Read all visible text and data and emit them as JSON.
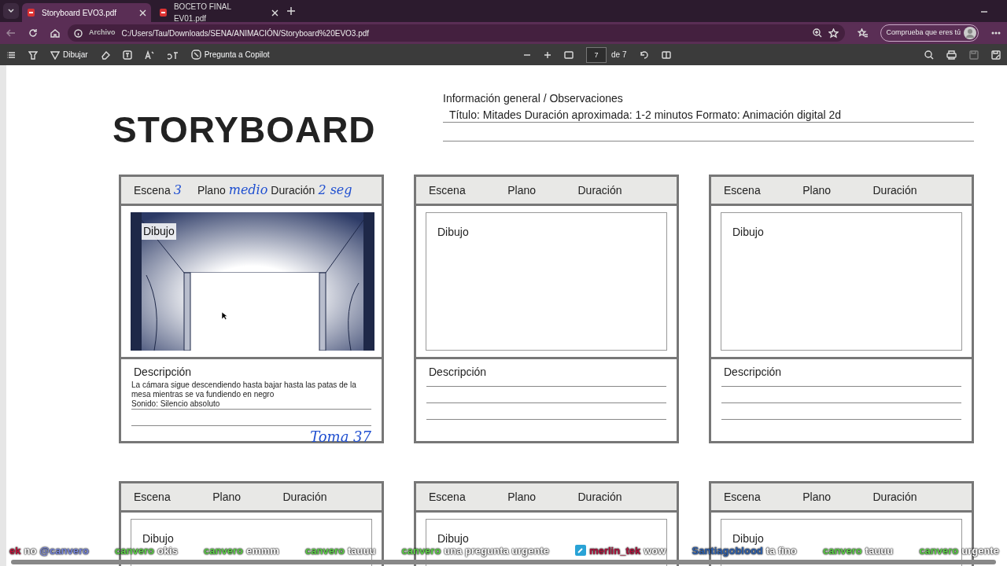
{
  "tabs": [
    {
      "label": "Storyboard EVO3.pdf",
      "selected": true
    },
    {
      "label": "BOCETO FINAL EV01.pdf",
      "selected": false
    }
  ],
  "address": {
    "prefix": "Archivo",
    "url": "C:/Users/Tau/Downloads/SENA/ANIMACIÓN/Storyboard%20EVO3.pdf"
  },
  "profile_button": "Comprueba que eres tú",
  "toolbar": {
    "draw": "Dibujar",
    "copilot": "Pregunta a Copilot",
    "page": "7",
    "page_total": "de 7"
  },
  "document": {
    "title": "STORYBOARD",
    "info_heading": "Información general / Observaciones",
    "info_text": "Título: Mitades Duración aproximada: 1-2 minutos Formato: Animación digital 2d",
    "panels": [
      {
        "kind": "full",
        "scene": "Escena",
        "scene_value": "3",
        "shot": "Plano",
        "shot_value": "medio",
        "duration": "Duración",
        "duration_value": "2 seg",
        "drawing": "Dibujo",
        "sketch": true,
        "description": "Descripción",
        "description_text": "La cámara sigue descendiendo hasta bajar hasta las patas de la mesa mientras se va fundiendo en negro\nSonido: Silencio absoluto",
        "note": "Toma 37"
      },
      {
        "kind": "full",
        "scene": "Escena",
        "shot": "Plano",
        "duration": "Duración",
        "drawing": "Dibujo",
        "sketch": false,
        "description": "Descripción"
      },
      {
        "kind": "full",
        "scene": "Escena",
        "shot": "Plano",
        "duration": "Duración",
        "drawing": "Dibujo",
        "sketch": false,
        "description": "Descripción"
      },
      {
        "kind": "partial",
        "scene": "Escena",
        "shot": "Plano",
        "duration": "Duración",
        "drawing": "Dibujo",
        "sketch": false
      },
      {
        "kind": "partial",
        "scene": "Escena",
        "shot": "Plano",
        "duration": "Duración",
        "drawing": "Dibujo",
        "sketch": false
      },
      {
        "kind": "partial",
        "scene": "Escena",
        "shot": "Plano",
        "duration": "Duración",
        "drawing": "Dibujo",
        "sketch": false
      }
    ]
  },
  "chat": [
    {
      "user": "ek",
      "color": "#c0143c",
      "text": "no",
      "mention": "@canvero",
      "badge": false
    },
    {
      "user": "canvero",
      "color": "#5fd34a",
      "text": "okis",
      "badge": false
    },
    {
      "user": "canvero",
      "color": "#5fd34a",
      "text": "emmm",
      "badge": false
    },
    {
      "user": "canvero",
      "color": "#5fd34a",
      "text": "tauuu",
      "badge": false
    },
    {
      "user": "canvero",
      "color": "#5fd34a",
      "text": "una pregunta urgente",
      "badge": false
    },
    {
      "user": "merlin_tek",
      "color": "#b0123c",
      "text": "wow",
      "badge": true
    },
    {
      "user": "Santiagoblood",
      "color": "#2f62b0",
      "text": "ta fino",
      "badge": false
    },
    {
      "user": "canvero",
      "color": "#5fd34a",
      "text": "tauuu",
      "badge": false
    },
    {
      "user": "canvero",
      "color": "#5fd34a",
      "text": "urgente",
      "badge": false
    }
  ]
}
